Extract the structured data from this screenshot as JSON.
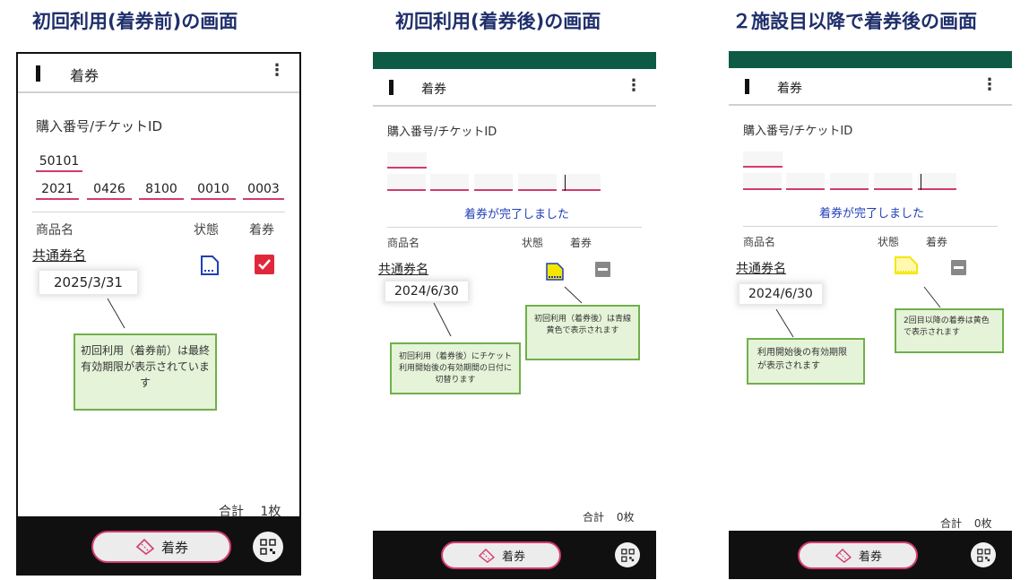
{
  "captions": [
    "初回利用(着券前)の画面",
    "初回利用(着券後)の画面",
    "２施設目以降で着券後の画面"
  ],
  "colors": {
    "caption": "#1f2f6b",
    "status_bar": "#0d5a45",
    "field_underline": "#d33c6b",
    "done_text": "#1f3fb8",
    "note_bg": "#e5f3d8",
    "note_border": "#6fb04b",
    "check_red": "#e0283c",
    "ticket_yellow": "#f5e600"
  },
  "screens": [
    {
      "app_title": "着券",
      "menu_icon": "more-vert-icon",
      "id_label": "購入番号/チケットID",
      "purchase_no": "50101",
      "ticket_parts": [
        "2021",
        "0426",
        "8100",
        "0010",
        "0003"
      ],
      "col_product": "商品名",
      "col_status": "状態",
      "col_checkin": "着券",
      "product_name": "共通券名",
      "date": "2025/3/31",
      "status_icon": "ticket-outline-icon",
      "checkin_icon": "checkbox-checked-icon",
      "note": "初回利用（着券前）は最終有効期限が表示されています",
      "total_label": "合計",
      "total_value": "1枚",
      "button_label": "着券",
      "button_icon": "ticket-icon",
      "qr_icon": "qr-code-icon"
    },
    {
      "app_title": "着券",
      "id_label": "購入番号/チケットID",
      "done_message": "着券が完了しました",
      "col_product": "商品名",
      "col_status": "状態",
      "col_checkin": "着券",
      "product_name": "共通券名",
      "date": "2024/6/30",
      "status_icon": "ticket-filled-icon",
      "checkin_icon": "checkbox-indeterminate-icon",
      "note_status": "初回利用（着券後）は青線黄色で表示されます",
      "note_date": "初回利用（着券後）にチケット利用開始後の有効期間の日付に切替ります",
      "total_label": "合計",
      "total_value": "0枚",
      "button_label": "着券"
    },
    {
      "app_title": "着券",
      "id_label": "購入番号/チケットID",
      "done_message": "着券が完了しました",
      "col_product": "商品名",
      "col_status": "状態",
      "col_checkin": "着券",
      "product_name": "共通券名",
      "date": "2024/6/30",
      "status_icon": "ticket-yellow-icon",
      "checkin_icon": "checkbox-indeterminate-icon",
      "note_status": "2回目以降の着券は黄色で表示されます",
      "note_date": "利用開始後の有効期限が表示されます",
      "total_label": "合計",
      "total_value": "0枚",
      "button_label": "着券"
    }
  ]
}
